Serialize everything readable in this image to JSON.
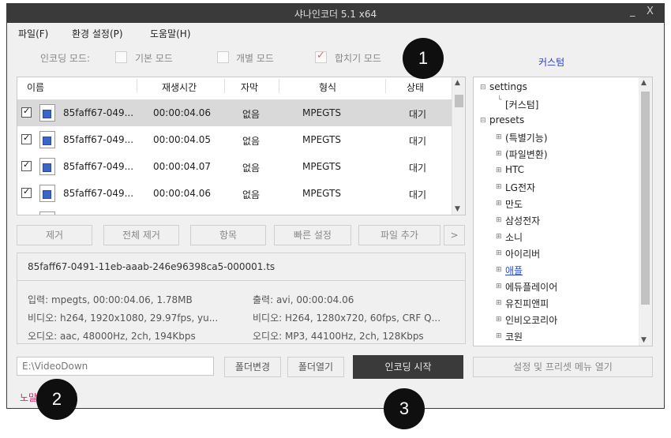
{
  "window": {
    "title": "샤나인코더  5.1 x64",
    "minimize_label": "_",
    "close_label": "X"
  },
  "menu": {
    "items": [
      "파일(F)",
      "환경 설정(P)",
      "도움말(H)"
    ]
  },
  "modes": {
    "label": "인코딩 모드:",
    "basic": "기본 모드",
    "individual": "개별 모드",
    "merge": "합치기 모드",
    "merge_checked": true,
    "custom": "커스텀"
  },
  "table": {
    "columns": [
      "이름",
      "재생시간",
      "자막",
      "형식",
      "상태"
    ],
    "rows": [
      {
        "name": "85faff67-049...",
        "duration": "00:00:04.06",
        "subtitle": "없음",
        "format": "MPEGTS",
        "status": "대기"
      },
      {
        "name": "85faff67-049...",
        "duration": "00:00:04.05",
        "subtitle": "없음",
        "format": "MPEGTS",
        "status": "대기"
      },
      {
        "name": "85faff67-049...",
        "duration": "00:00:04.07",
        "subtitle": "없음",
        "format": "MPEGTS",
        "status": "대기"
      },
      {
        "name": "85faff67-049...",
        "duration": "00:00:04.06",
        "subtitle": "없음",
        "format": "MPEGTS",
        "status": "대기"
      }
    ]
  },
  "actions": {
    "remove": "제거",
    "remove_all": "전체 제거",
    "items": "항목",
    "quick_settings": "빠른 설정",
    "add_file": "파일 추가",
    "more": ">"
  },
  "info": {
    "filename": "85faff67-0491-11eb-aaab-246e96398ca5-000001.ts",
    "input": "입력: mpegts, 00:00:04.06, 1.78MB",
    "video_in": "비디오: h264, 1920x1080, 29.97fps,  yu...",
    "audio_in": "오디오: aac, 48000Hz, 2ch, 194Kbps",
    "output": "출력: avi, 00:00:04.06",
    "video_out": "비디오: H264, 1280x720, 60fps, CRF Q...",
    "audio_out": "오디오: MP3, 44100Hz, 2ch, 128Kbps"
  },
  "tree": {
    "settings": "settings",
    "custom": "[커스텀]",
    "presets": "presets",
    "children": [
      "(특별기능)",
      "(파일변환)",
      "HTC",
      "LG전자",
      "만도",
      "삼성전자",
      "소니",
      "아이리버",
      "애플",
      "에듀플레이어",
      "유진피앤피",
      "인비오코리아",
      "코원"
    ]
  },
  "bottom": {
    "path": "E:\\VideoDown",
    "change_folder": "폴더변경",
    "open_folder": "폴더열기",
    "start": "인코딩 시작",
    "open_menu": "설정 및 프리셋 메뉴 열기"
  },
  "status": {
    "text": "노말 모드 관련"
  },
  "markers": [
    "1",
    "2",
    "3"
  ]
}
